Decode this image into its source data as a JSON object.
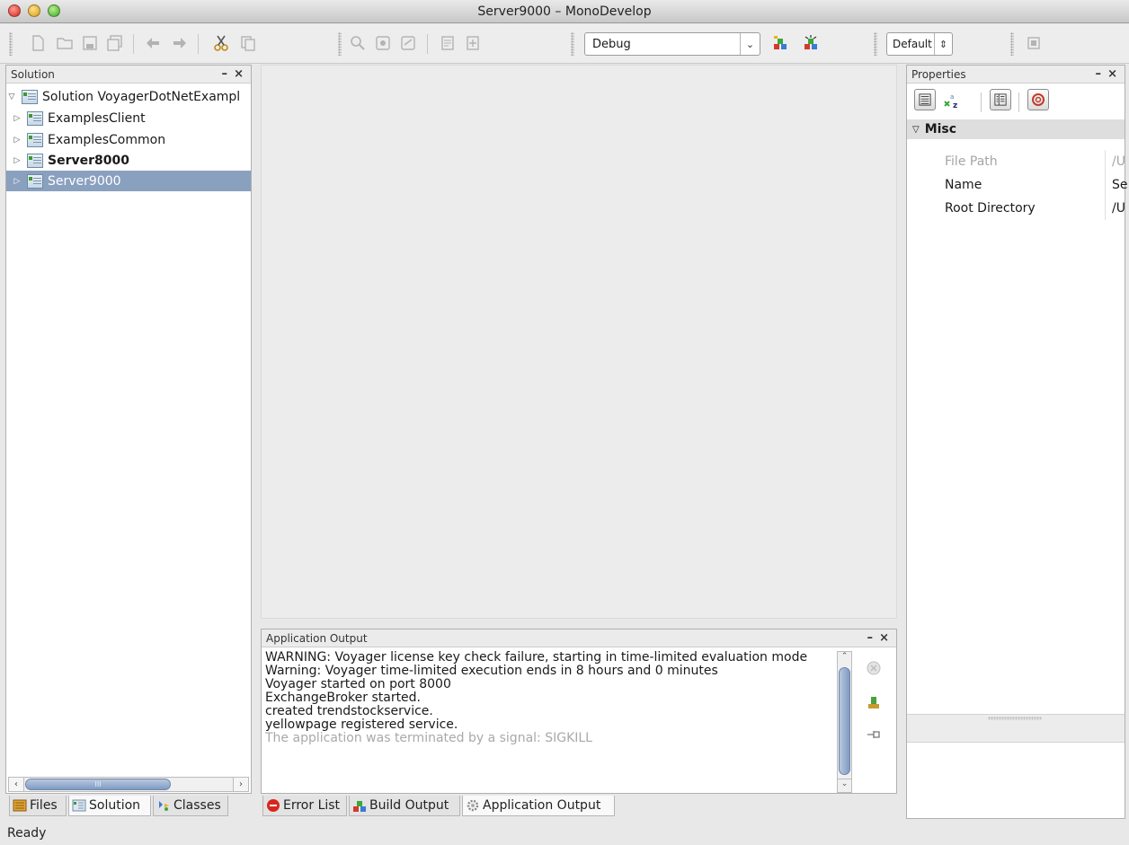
{
  "window": {
    "title": "Server9000 – MonoDevelop"
  },
  "toolbar": {
    "config_value": "Debug",
    "layout_value": "Default"
  },
  "solution_pad": {
    "title": "Solution",
    "root": "Solution VoyagerDotNetExampl",
    "items": [
      {
        "label": "ExamplesClient",
        "bold": false,
        "selected": false
      },
      {
        "label": "ExamplesCommon",
        "bold": false,
        "selected": false
      },
      {
        "label": "Server8000",
        "bold": true,
        "selected": false
      },
      {
        "label": "Server9000",
        "bold": false,
        "selected": true
      }
    ],
    "scroll_grip": "III"
  },
  "left_tabs": [
    {
      "label": "Files",
      "icon": "files-icon"
    },
    {
      "label": "Solution",
      "icon": "solution-icon"
    },
    {
      "label": "Classes",
      "icon": "classes-icon"
    }
  ],
  "output_pad": {
    "title": "Application Output",
    "lines": [
      "WARNING: Voyager license key check failure, starting in time-limited evaluation mode",
      "Warning: Voyager time-limited execution ends in 8 hours and 0 minutes",
      "Voyager started on port 8000",
      "ExchangeBroker started.",
      "created trendstockservice.",
      "yellowpage registered service."
    ],
    "terminated_line": "The application was terminated by a signal: SIGKILL"
  },
  "bottom_tabs": [
    {
      "label": "Error List",
      "icon": "error-icon"
    },
    {
      "label": "Build Output",
      "icon": "build-icon"
    },
    {
      "label": "Application Output",
      "icon": "gear-icon"
    }
  ],
  "properties_pad": {
    "title": "Properties",
    "section": "Misc",
    "rows": [
      {
        "key": "File Path",
        "value": "/U",
        "dim": true
      },
      {
        "key": "Name",
        "value": "Se",
        "dim": false
      },
      {
        "key": "Root Directory",
        "value": "/U",
        "dim": false
      }
    ]
  },
  "pad_controls": {
    "minimize": "–",
    "close": "×"
  },
  "status": {
    "text": "Ready"
  },
  "colors": {
    "selection": "#8aa0bf",
    "accent_scroll": "#7f9bc4"
  }
}
